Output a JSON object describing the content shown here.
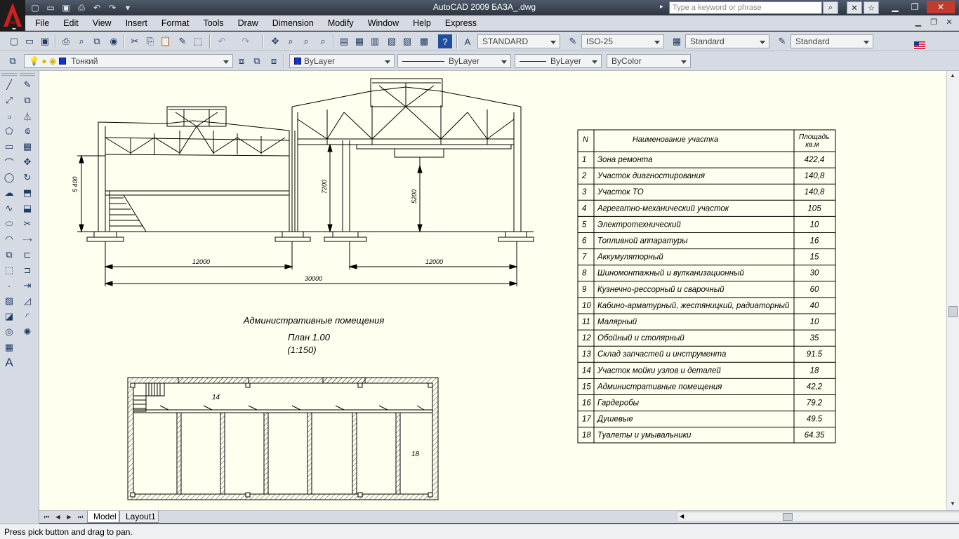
{
  "window": {
    "title": "AutoCAD 2009 БАЗА_.dwg",
    "search_placeholder": "Type a keyword or phrase"
  },
  "menu": [
    "File",
    "Edit",
    "View",
    "Insert",
    "Format",
    "Tools",
    "Draw",
    "Dimension",
    "Modify",
    "Window",
    "Help",
    "Express"
  ],
  "toolbar": {
    "text_style": "STANDARD",
    "dim_style": "ISO-25",
    "table_style": "Standard",
    "multileader_style": "Standard",
    "layer": "Тонкий",
    "color": "ByLayer",
    "linetype": "ByLayer",
    "lineweight": "ByLayer",
    "plot_style": "ByColor"
  },
  "tabs": [
    "Model",
    "Layout1"
  ],
  "status": {
    "command_line": "Press pick button and drag to pan."
  },
  "drawing": {
    "dims": {
      "left_height": "5 400",
      "mid_height": "7200",
      "right_height": "5200",
      "span_left": "12000",
      "span_right": "12000",
      "span_total": "30000"
    },
    "plan_title": "Административные помещения",
    "plan_subtitle": "План 1.00",
    "plan_scale": "(1:150)",
    "plan_room_14": "14",
    "plan_room_18": "18",
    "table": {
      "headers": {
        "n": "N",
        "name": "Наименование участка",
        "area": "Площадь кв.м"
      },
      "rows": [
        {
          "n": "1",
          "name": "Зона ремонта",
          "area": "422,4"
        },
        {
          "n": "2",
          "name": "Участок диагностирования",
          "area": "140,8"
        },
        {
          "n": "3",
          "name": "Участок ТО",
          "area": "140,8"
        },
        {
          "n": "4",
          "name": "Агрегатно-механический участок",
          "area": "105"
        },
        {
          "n": "5",
          "name": "Электротехнический",
          "area": "10"
        },
        {
          "n": "6",
          "name": "Топливной аппаратуры",
          "area": "16"
        },
        {
          "n": "7",
          "name": "Аккумуляторный",
          "area": "15"
        },
        {
          "n": "8",
          "name": "Шиномонтажный и вулканизационный",
          "area": "30"
        },
        {
          "n": "9",
          "name": "Кузнечно-рессорный и сварочный",
          "area": "60"
        },
        {
          "n": "10",
          "name": "Кабино-арматурный, жестяницкий, радиаторный",
          "area": "40"
        },
        {
          "n": "11",
          "name": "Малярный",
          "area": "10"
        },
        {
          "n": "12",
          "name": "Обойный и столярный",
          "area": "35"
        },
        {
          "n": "13",
          "name": "Склад запчастей и инструмента",
          "area": "91.5"
        },
        {
          "n": "14",
          "name": "Участок мойки узлов и деталей",
          "area": "18"
        },
        {
          "n": "15",
          "name": "Административные помещения",
          "area": "42,2"
        },
        {
          "n": "16",
          "name": "Гардеробы",
          "area": "79.2"
        },
        {
          "n": "17",
          "name": "Душевые",
          "area": "49.5"
        },
        {
          "n": "18",
          "name": "Туалеты и умывальники",
          "area": "64.35"
        }
      ]
    }
  }
}
